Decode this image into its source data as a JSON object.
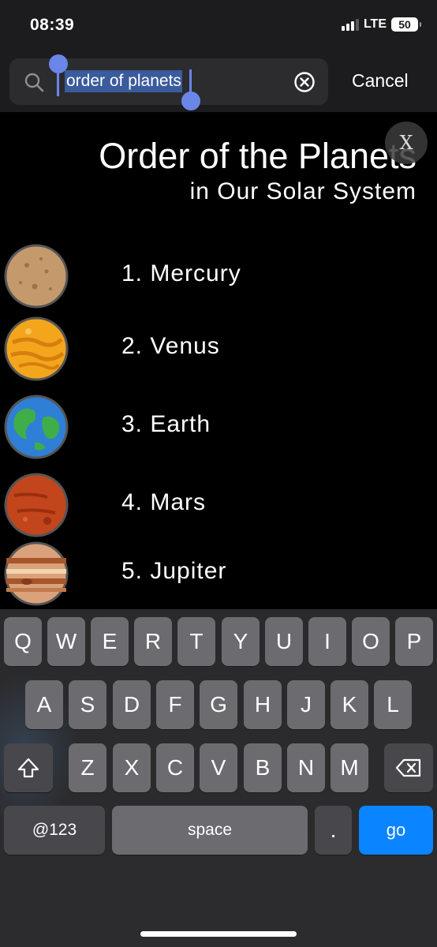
{
  "status_bar": {
    "time": "08:39",
    "network": "LTE",
    "battery": "50"
  },
  "search": {
    "value": "order of planets",
    "cancel_label": "Cancel"
  },
  "image": {
    "title": "Order of the Planets",
    "subtitle": "in Our Solar System",
    "close_label": "X",
    "planets": [
      {
        "label": "1. Mercury",
        "color": "#c49a6c"
      },
      {
        "label": "2. Venus",
        "color": "#f3a61c"
      },
      {
        "label": "3. Earth",
        "color": "#2f7fd6"
      },
      {
        "label": "4. Mars",
        "color": "#c2451c"
      },
      {
        "label": "5. Jupiter",
        "color": "#d9a27a"
      }
    ]
  },
  "keyboard": {
    "row1": [
      "Q",
      "W",
      "E",
      "R",
      "T",
      "Y",
      "U",
      "I",
      "O",
      "P"
    ],
    "row2": [
      "A",
      "S",
      "D",
      "F",
      "G",
      "H",
      "J",
      "K",
      "L"
    ],
    "row3": [
      "Z",
      "X",
      "C",
      "V",
      "B",
      "N",
      "M"
    ],
    "shift_icon": "shift-icon",
    "delete_icon": "delete-icon",
    "numbers_label": "@123",
    "space_label": "space",
    "period_label": ".",
    "go_label": "go"
  }
}
